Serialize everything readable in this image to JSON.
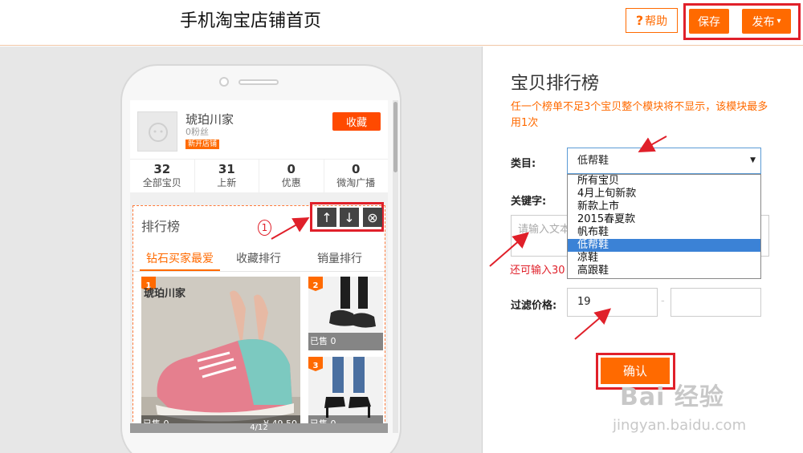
{
  "header": {
    "title": "手机淘宝店铺首页",
    "help_label": "帮助",
    "help_symbol": "?",
    "save_label": "保存",
    "publish_label": "发布",
    "publish_caret": "▾"
  },
  "shop": {
    "name": "琥珀川家",
    "fans": "0粉丝",
    "badge": "新开店铺",
    "favorite_label": "收藏",
    "stats": [
      {
        "value": "32",
        "label": "全部宝贝"
      },
      {
        "value": "31",
        "label": "上新"
      },
      {
        "value": "0",
        "label": "优惠"
      },
      {
        "value": "0",
        "label": "微淘广播"
      }
    ]
  },
  "ranking_module": {
    "title": "排行榜",
    "annotation_number": "1",
    "controls": {
      "up": "↑",
      "down": "↓",
      "delete": "⊗"
    },
    "tabs": [
      "钻石买家最爱",
      "收藏排行",
      "销量排行"
    ],
    "products": [
      {
        "rank": "1",
        "shop_watermark": "琥珀川家",
        "sold": "已售 0",
        "price": "¥ 49.50"
      },
      {
        "rank": "2",
        "sold": "已售 0"
      },
      {
        "rank": "3",
        "sold": "已售 0"
      }
    ],
    "pager": "4/12"
  },
  "panel": {
    "title": "宝贝排行榜",
    "warning": "任一个榜单不足3个宝贝整个模块将不显示，该模块最多用1次",
    "category_label": "类目:",
    "category_value": "低帮鞋",
    "select_caret": "▼",
    "category_options": [
      "所有宝贝",
      "4月上旬新款",
      "新款上市",
      "2015春夏款",
      "帆布鞋",
      "低帮鞋",
      "凉鞋",
      "高跟鞋"
    ],
    "selected_option_index": 5,
    "keyword_label": "关键字:",
    "keyword_placeholder": "请输入文本",
    "remaining_text": "还可输入30",
    "price_label": "过滤价格:",
    "price_min": "19",
    "price_max": "",
    "price_separator": "-",
    "confirm_label": "确认"
  },
  "watermark": {
    "brand": "Bai 经验",
    "url": "jingyan.baidu.com"
  },
  "colors": {
    "accent": "#ff6a00",
    "highlight": "#e0202a",
    "selected_option": "#3b82d6"
  }
}
